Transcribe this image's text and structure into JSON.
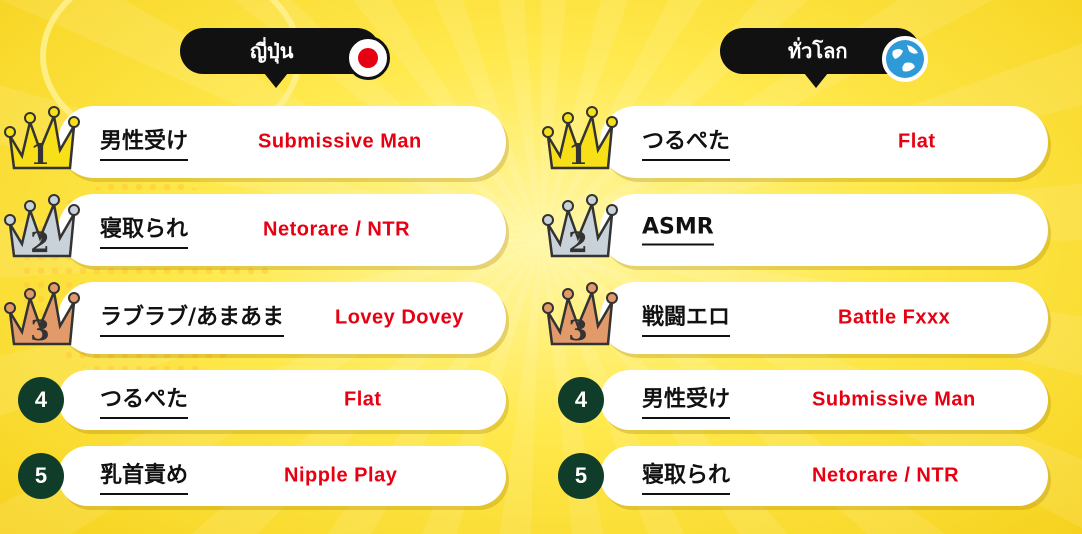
{
  "left": {
    "title": "ญี่ปุ่น",
    "icon": "japan-flag-icon",
    "items": [
      {
        "rank": "1",
        "jp": "男性受け",
        "en": "Submissive Man"
      },
      {
        "rank": "2",
        "jp": "寝取られ",
        "en": "Netorare / NTR"
      },
      {
        "rank": "3",
        "jp": "ラブラブ/あまあま",
        "en": "Lovey Dovey"
      },
      {
        "rank": "4",
        "jp": "つるぺた",
        "en": "Flat"
      },
      {
        "rank": "5",
        "jp": "乳首責め",
        "en": "Nipple Play"
      }
    ]
  },
  "right": {
    "title": "ทั่วโลก",
    "icon": "globe-icon",
    "items": [
      {
        "rank": "1",
        "jp": "つるぺた",
        "en": "Flat"
      },
      {
        "rank": "2",
        "jp": "ASMR",
        "en": ""
      },
      {
        "rank": "3",
        "jp": "戦闘エロ",
        "en": "Battle Fxxx"
      },
      {
        "rank": "4",
        "jp": "男性受け",
        "en": "Submissive Man"
      },
      {
        "rank": "5",
        "jp": "寝取られ",
        "en": "Netorare / NTR"
      }
    ]
  },
  "colors": {
    "gold": "#f7e017",
    "silver": "#c9d2d8",
    "bronze": "#e39a6a",
    "accent_red": "#e60012",
    "rank_circle": "#0f3d2a"
  }
}
